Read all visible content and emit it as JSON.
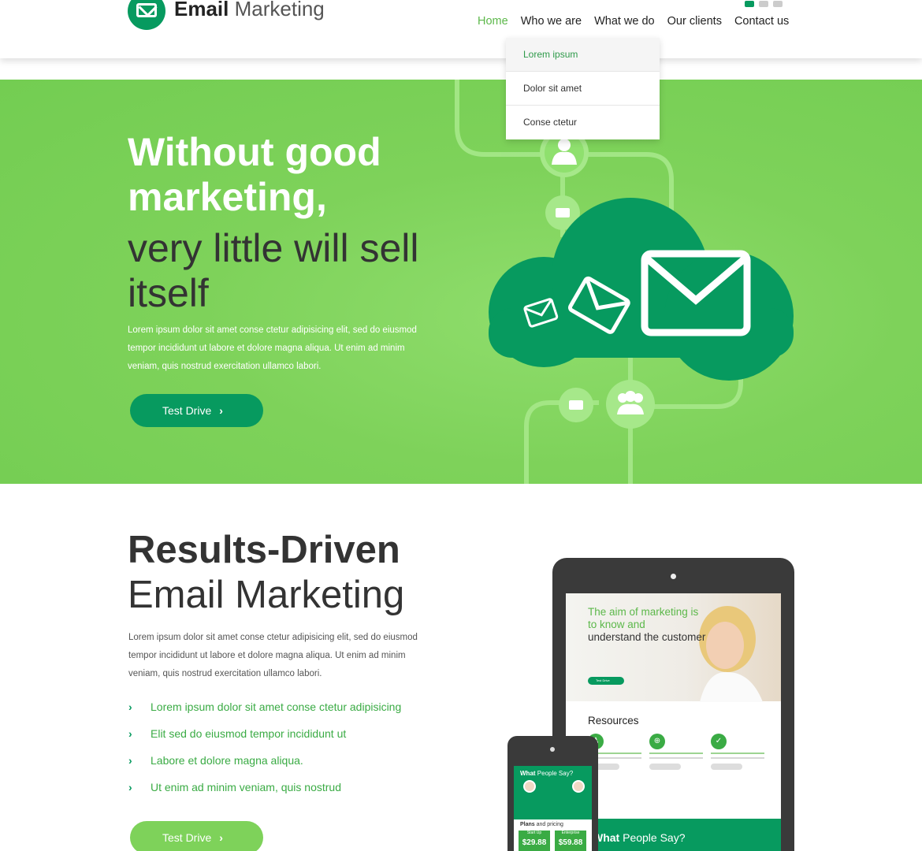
{
  "brand": {
    "bold": "Email",
    "light": "Marketing"
  },
  "nav": {
    "items": [
      "Home",
      "Who we are",
      "What we do",
      "Our clients",
      "Contact us"
    ]
  },
  "dropdown": {
    "items": [
      "Lorem ipsum",
      "Dolor sit amet",
      "Conse ctetur"
    ]
  },
  "hero": {
    "title_bold": "Without good marketing,",
    "title_light": "very little will sell itself",
    "body": "Lorem ipsum dolor sit amet conse ctetur adipisicing elit, sed do eiusmod tempor incididunt ut labore et dolore magna aliqua. Ut enim ad minim veniam, quis nostrud exercitation ullamco labori.",
    "button": "Test Drive"
  },
  "results": {
    "title_bold": "Results-Driven",
    "title_light": "Email Marketing",
    "body": "Lorem ipsum dolor sit amet conse ctetur adipisicing elit, sed do eiusmod tempor incididunt ut labore et dolore magna aliqua. Ut enim ad minim veniam, quis nostrud exercitation ullamco labori.",
    "checks": [
      "Lorem ipsum dolor sit amet conse ctetur adipisicing",
      "Elit sed do eiusmod tempor incididunt ut",
      "Labore et dolore magna aliqua.",
      "Ut enim ad minim veniam, quis nostrud"
    ],
    "button": "Test Drive"
  },
  "tablet": {
    "hero_green": "The aim of marketing is to know and",
    "hero_dark": "understand the customer",
    "hero_button": "Test Drive",
    "resources_title": "Resources",
    "bottom_bold": "What",
    "bottom_light": "People Say?"
  },
  "phone": {
    "title_bold": "What",
    "title_light": "People Say?",
    "plans_bold": "Plans",
    "plans_light": "and pricing",
    "plans": [
      {
        "name": "Start Up",
        "price": "$29.88"
      },
      {
        "name": "Enterprise",
        "price": "$59.88"
      }
    ]
  },
  "colors": {
    "green_dark": "#079a5f",
    "green_light": "#7ed25a",
    "accent": "#5cb84a"
  }
}
